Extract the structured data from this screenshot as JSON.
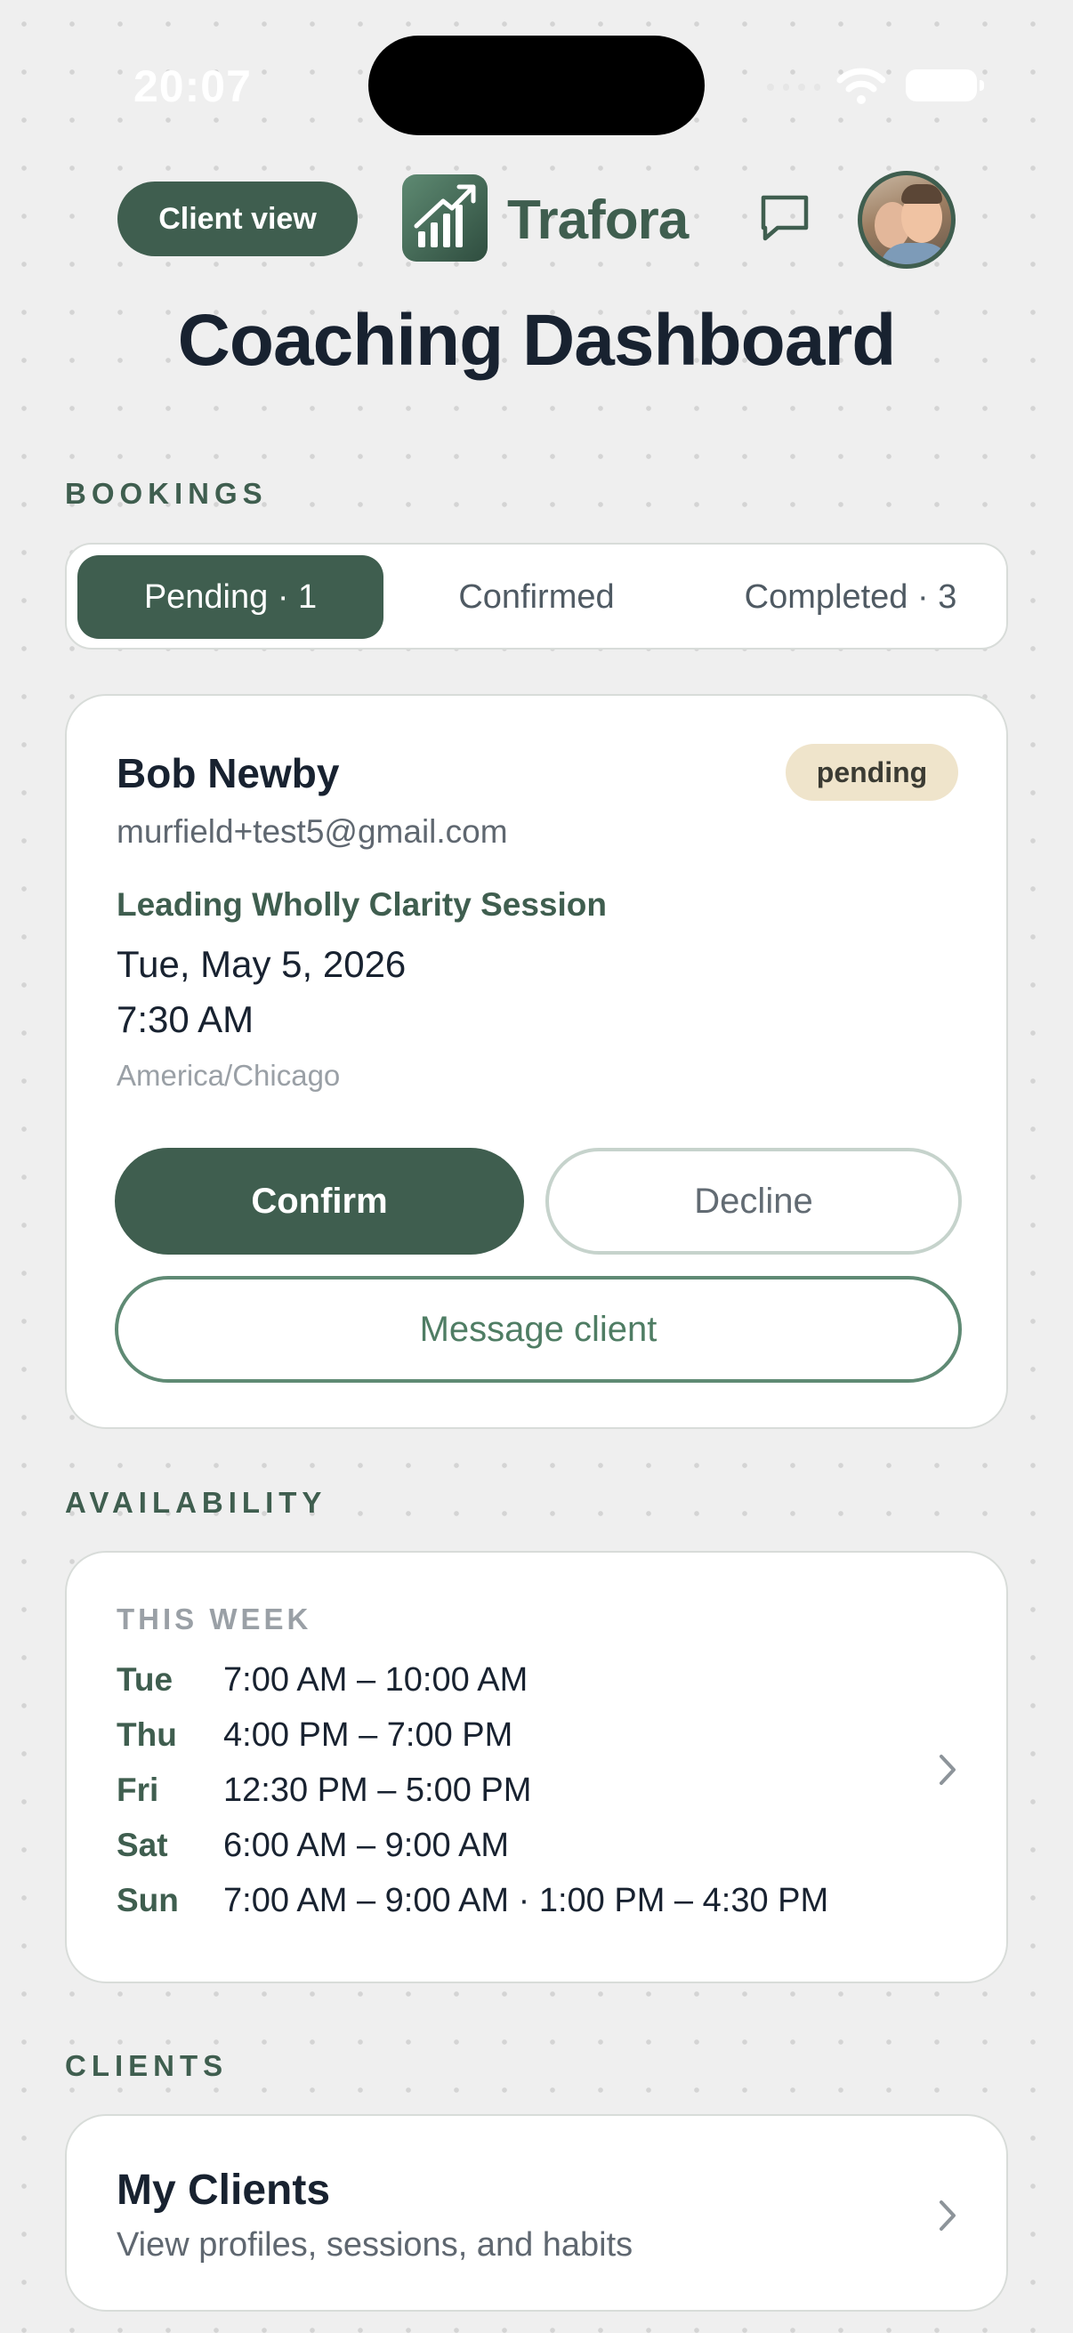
{
  "status_bar": {
    "time": "20:07"
  },
  "header": {
    "client_view_label": "Client view",
    "logo_text": "Trafora",
    "logo_icon": "growth-chart-icon",
    "message_icon": "chat-bubble-icon",
    "avatar": "profile-photo"
  },
  "page": {
    "title": "Coaching Dashboard"
  },
  "bookings": {
    "section_label": "BOOKINGS",
    "tabs": [
      {
        "label": "Pending · 1",
        "active": true
      },
      {
        "label": "Confirmed",
        "active": false
      },
      {
        "label": "Completed · 3",
        "active": false
      }
    ],
    "card": {
      "client_name": "Bob Newby",
      "status": "pending",
      "email": "murfield+test5@gmail.com",
      "session_name": "Leading Wholly Clarity Session",
      "date": "Tue, May 5, 2026",
      "time": "7:30 AM",
      "timezone": "America/Chicago",
      "confirm_label": "Confirm",
      "decline_label": "Decline",
      "message_label": "Message client"
    }
  },
  "availability": {
    "section_label": "AVAILABILITY",
    "week_label": "THIS WEEK",
    "rows": [
      {
        "day": "Tue",
        "times": "7:00 AM – 10:00 AM"
      },
      {
        "day": "Thu",
        "times": "4:00 PM – 7:00 PM"
      },
      {
        "day": "Fri",
        "times": "12:30 PM – 5:00 PM"
      },
      {
        "day": "Sat",
        "times": "6:00 AM – 9:00 AM"
      },
      {
        "day": "Sun",
        "times": "7:00 AM – 9:00 AM  ·  1:00 PM – 4:30 PM"
      }
    ]
  },
  "clients": {
    "section_label": "CLIENTS",
    "title": "My Clients",
    "subtitle": "View profiles, sessions, and habits"
  },
  "colors": {
    "accent": "#3f5e4f",
    "background": "#efefef",
    "badge_pending": "#efe4cb"
  }
}
